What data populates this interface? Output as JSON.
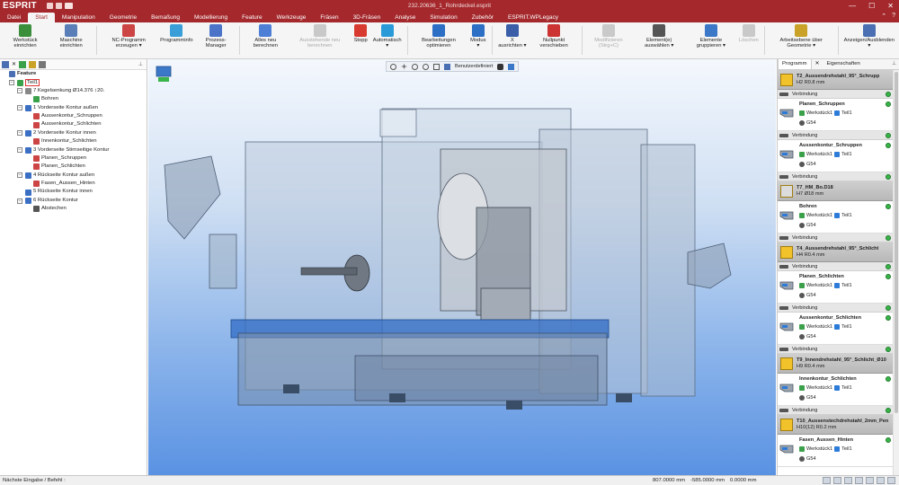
{
  "app": {
    "logo": "ESPRIT",
    "window_title": "232.20636_1_Rohrdeckel.esprit",
    "quick_access": [
      "G01\nM01"
    ]
  },
  "menu": {
    "tabs": [
      "Datei",
      "Start",
      "Manipulation",
      "Geometrie",
      "Bemaßung",
      "Modellierung",
      "Feature",
      "Werkzeuge",
      "Fräsen",
      "3D-Fräsen",
      "Analyse",
      "Simulation",
      "Zubehör",
      "ESPRIT.WPLegacy"
    ],
    "active": "Start"
  },
  "ribbon": [
    {
      "name": "werkstueck",
      "label": "Werkstück einrichten",
      "color": "#3b8f3b",
      "disabled": false
    },
    {
      "name": "maschine",
      "label": "Maschine einrichten",
      "color": "#5a7fb8",
      "disabled": false
    },
    {
      "sep": true
    },
    {
      "name": "nc-programm",
      "label": "NC-Programm erzeugen ▾",
      "color": "#c44",
      "disabled": false
    },
    {
      "name": "programminfo",
      "label": "Programminfo",
      "color": "#3a9fd8",
      "disabled": false
    },
    {
      "name": "prozess-manager",
      "label": "Prozess-Manager",
      "color": "#4b74c9",
      "disabled": false
    },
    {
      "sep": true
    },
    {
      "name": "alles-neu",
      "label": "Alles neu berechnen",
      "color": "#4d7fd6",
      "disabled": false
    },
    {
      "name": "ausstehende",
      "label": "Ausstehende neu berechnen",
      "color": "#777",
      "disabled": true
    },
    {
      "name": "stopp",
      "label": "Stopp",
      "color": "#d93a2f",
      "disabled": false
    },
    {
      "name": "automatisch",
      "label": "Automatisch ▾",
      "color": "#2b9bd8",
      "disabled": false
    },
    {
      "sep": true
    },
    {
      "name": "bearbeitungen",
      "label": "Bearbeitungen optimieren",
      "color": "#2c6fc4",
      "disabled": false
    },
    {
      "name": "modus",
      "label": "Modus ▾",
      "color": "#2c6fc4",
      "disabled": false
    },
    {
      "sep": true
    },
    {
      "name": "x-ausrichten",
      "label": "X ausrichten ▾",
      "color": "#3a5ea8",
      "disabled": false
    },
    {
      "name": "nullpunkt",
      "label": "Nullpunkt verschieben",
      "color": "#c33",
      "disabled": false
    },
    {
      "sep": true
    },
    {
      "name": "modifizieren",
      "label": "Modifizieren (Strg+C)",
      "color": "#777",
      "disabled": true
    },
    {
      "name": "elemente-auswaehlen",
      "label": "Element(e) auswählen ▾",
      "color": "#555",
      "disabled": false
    },
    {
      "name": "elemente-gruppieren",
      "label": "Elemente gruppieren ▾",
      "color": "#3c78c8",
      "disabled": false
    },
    {
      "name": "loeschen",
      "label": "Löschen",
      "color": "#777",
      "disabled": true
    },
    {
      "sep": true
    },
    {
      "name": "arbeitsebene",
      "label": "Arbeitsebene über Geometrie ▾",
      "color": "#c9a227",
      "disabled": false
    },
    {
      "sep": true
    },
    {
      "name": "anzeigen",
      "label": "Anzeigen/Ausblenden ▾",
      "color": "#4a6fb3",
      "disabled": false
    }
  ],
  "tree": [
    {
      "label": "Feature",
      "indent": 0,
      "bold": true,
      "exp": "",
      "icon": "#4a6fb3"
    },
    {
      "label": "Teil1",
      "indent": 1,
      "exp": "−",
      "icon": "#3aa04a",
      "boxed": true
    },
    {
      "label": "7 Kegelsenkung Ø14.376 ↕20.",
      "indent": 2,
      "exp": "−",
      "icon": "#888"
    },
    {
      "label": "Bohren",
      "indent": 3,
      "exp": "",
      "icon": "#3aa04a"
    },
    {
      "label": "1 Vorderseite Kontur außen",
      "indent": 2,
      "exp": "−",
      "icon": "#3a6fc4"
    },
    {
      "label": "Aussenkontur_Schruppen",
      "indent": 3,
      "exp": "",
      "icon": "#c44"
    },
    {
      "label": "Aussenkontur_Schlichten",
      "indent": 3,
      "exp": "",
      "icon": "#c44"
    },
    {
      "label": "2 Vorderseite Kontur innen",
      "indent": 2,
      "exp": "−",
      "icon": "#3a6fc4"
    },
    {
      "label": "Innenkontur_Schlichten",
      "indent": 3,
      "exp": "",
      "icon": "#c44"
    },
    {
      "label": "3 Vorderseite Stirnseitige Kontur",
      "indent": 2,
      "exp": "−",
      "icon": "#3a6fc4"
    },
    {
      "label": "Planen_Schruppen",
      "indent": 3,
      "exp": "",
      "icon": "#c44"
    },
    {
      "label": "Planen_Schlichten",
      "indent": 3,
      "exp": "",
      "icon": "#c44"
    },
    {
      "label": "4 Rückseite Kontur außen",
      "indent": 2,
      "exp": "−",
      "icon": "#3a6fc4"
    },
    {
      "label": "Fasen_Aussen_Hinten",
      "indent": 3,
      "exp": "",
      "icon": "#c44"
    },
    {
      "label": "5 Rückseite Kontur innen",
      "indent": 2,
      "exp": "",
      "icon": "#3a6fc4"
    },
    {
      "label": "6 Rückseite Kontur",
      "indent": 2,
      "exp": "−",
      "icon": "#3a6fc4"
    },
    {
      "label": "Abstechen",
      "indent": 3,
      "exp": "",
      "icon": "#555"
    }
  ],
  "viewport": {
    "toolbar_label": "Benutzerdefiniert"
  },
  "right_panel": {
    "tabs": [
      "Programm",
      "Eigenschaften"
    ],
    "active": "Programm",
    "items": [
      {
        "kind": "tool",
        "name": "T2_Aussendrehstahl_95°_Schrupp",
        "sub": "H2  R0.8 mm",
        "color": "#f2c22b"
      },
      {
        "kind": "conn",
        "label": "Verbindung"
      },
      {
        "kind": "op",
        "name": "Planen_Schruppen",
        "part": "Werkstück1",
        "teil": "Teil1",
        "g": "G54"
      },
      {
        "kind": "conn",
        "label": "Verbindung"
      },
      {
        "kind": "op",
        "name": "Aussenkontur_Schruppen",
        "part": "Werkstück1",
        "teil": "Teil1",
        "g": "G54"
      },
      {
        "kind": "conn",
        "label": "Verbindung"
      },
      {
        "kind": "tool",
        "name": "T7_HM_Bo.D18",
        "sub": "H7  Ø18 mm",
        "color": "#dcdcdc"
      },
      {
        "kind": "op",
        "name": "Bohren",
        "part": "Werkstück1",
        "teil": "Teil1",
        "g": "G54"
      },
      {
        "kind": "conn",
        "label": "Verbindung"
      },
      {
        "kind": "tool",
        "name": "T4_Aussendrehstahl_95°_Schlicht",
        "sub": "H4  R0.4 mm",
        "color": "#f2c22b"
      },
      {
        "kind": "conn",
        "label": "Verbindung"
      },
      {
        "kind": "op",
        "name": "Planen_Schlichten",
        "part": "Werkstück1",
        "teil": "Teil1",
        "g": "G54"
      },
      {
        "kind": "conn",
        "label": "Verbindung"
      },
      {
        "kind": "op",
        "name": "Aussenkontur_Schlichten",
        "part": "Werkstück1",
        "teil": "Teil1",
        "g": "G54"
      },
      {
        "kind": "conn",
        "label": "Verbindung"
      },
      {
        "kind": "tool",
        "name": "T9_Innendrehstahl_95°_Schlicht_Ø10",
        "sub": "H9  R0.4 mm",
        "color": "#f2c22b"
      },
      {
        "kind": "op",
        "name": "Innenkontur_Schlichten",
        "part": "Werkstück1",
        "teil": "Teil1",
        "g": "G54"
      },
      {
        "kind": "conn",
        "label": "Verbindung"
      },
      {
        "kind": "tool",
        "name": "T10_Aussenstechdrehstahl_2mm_Pen",
        "sub": "H10(12)  R0.2 mm",
        "color": "#f2c22b"
      },
      {
        "kind": "op",
        "name": "Fasen_Aussen_Hinten",
        "part": "Werkstück1",
        "teil": "Teil1",
        "g": "G54"
      }
    ]
  },
  "status": {
    "prompt": "Nächste Eingabe / Befehl :",
    "x": "807.0000 mm",
    "y": "-585.0000 mm",
    "z": "0.0000 mm"
  }
}
